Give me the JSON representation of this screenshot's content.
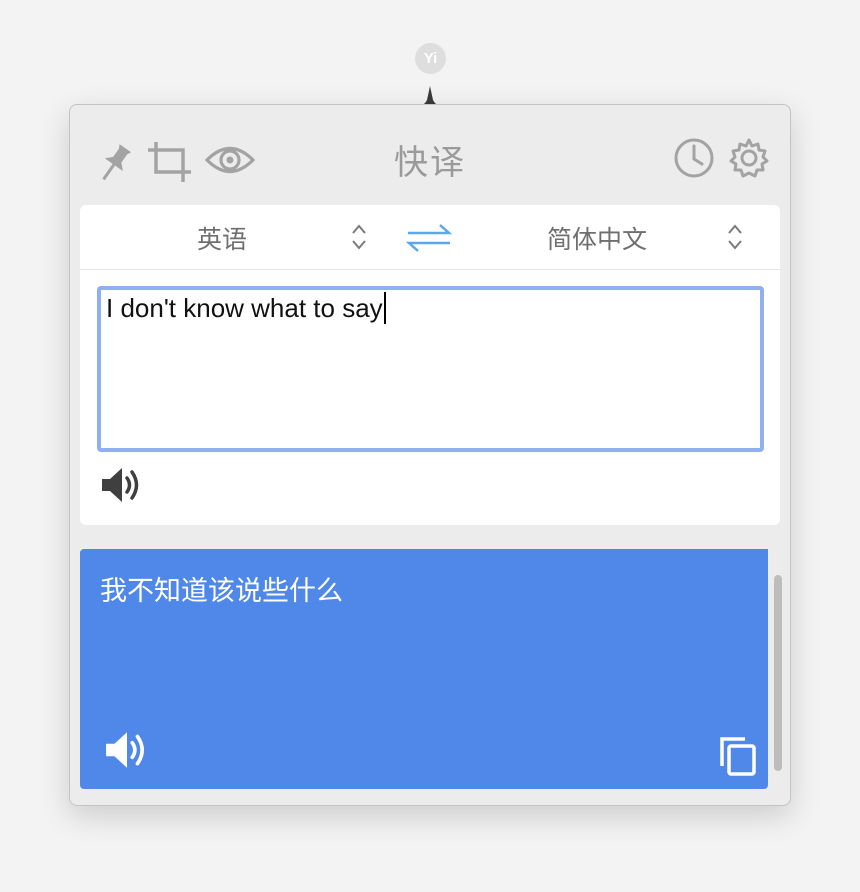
{
  "menubar": {
    "icon_name": "yi-app-icon",
    "icon_label": "Yi"
  },
  "window": {
    "title": "快译"
  },
  "toolbar": {
    "left_icons": [
      "pin-icon",
      "crop-icon",
      "eye-icon"
    ],
    "right_icons": [
      "history-clock-icon",
      "gear-icon"
    ]
  },
  "languages": {
    "source": "英语",
    "target": "简体中文",
    "swap_icon": "swap-arrows-icon"
  },
  "source": {
    "text": "I don't know what to say"
  },
  "result": {
    "text": "我不知道该说些什么"
  },
  "colors": {
    "accent": "#4f88e8",
    "focus_ring": "#8eb0ee",
    "swap_icon": "#5aa7ee",
    "panel_bg": "#ececec",
    "icon_gray": "#a3a3a3"
  }
}
